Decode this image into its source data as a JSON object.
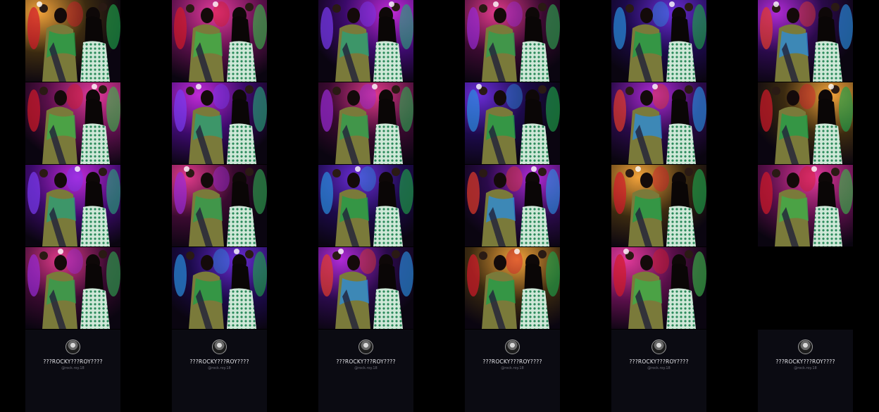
{
  "profile": {
    "display_name": "???ROCKY???ROY????",
    "handle": "@rock.roy.18",
    "avatar_icon": "profile-avatar-icon"
  },
  "grid": {
    "columns": 6,
    "rows_per_column": [
      4,
      4,
      4,
      4,
      4,
      3
    ],
    "tile_subject": "dance-video-frame"
  },
  "palette": {
    "background": "#000000",
    "footer_bg": "#0b0b12",
    "accents": [
      "#d21a8c",
      "#6a2cd6",
      "#e23a2a",
      "#1fa04a",
      "#f2c230",
      "#2a8de0"
    ]
  }
}
